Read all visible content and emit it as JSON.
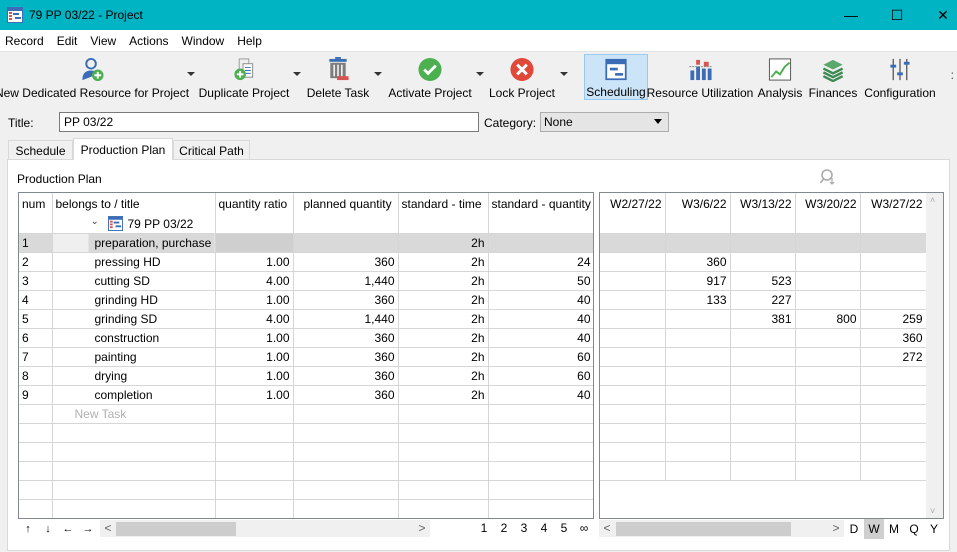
{
  "window": {
    "title": "79 PP 03/22 - Project",
    "controls": [
      "minimize",
      "maximize",
      "close"
    ]
  },
  "menu": [
    "Record",
    "Edit",
    "View",
    "Actions",
    "Window",
    "Help"
  ],
  "toolbar": {
    "buttons": [
      {
        "label": "New Dedicated Resource for Project",
        "icon": "add-user-icon",
        "has_dropdown": true
      },
      {
        "label": "Duplicate Project",
        "icon": "duplicate-icon",
        "has_dropdown": true
      },
      {
        "label": "Delete Task",
        "icon": "trash-icon",
        "has_dropdown": true
      },
      {
        "label": "Activate Project",
        "icon": "checkmark-icon",
        "has_dropdown": true
      },
      {
        "label": "Lock Project",
        "icon": "x-circle-icon",
        "has_dropdown": true
      },
      {
        "label": "Scheduling",
        "icon": "scheduling-icon",
        "active": true
      },
      {
        "label": "Resource Utilization",
        "icon": "bar-chart-icon"
      },
      {
        "label": "Analysis",
        "icon": "line-chart-icon"
      },
      {
        "label": "Finances",
        "icon": "money-icon"
      },
      {
        "label": "Configuration",
        "icon": "sliders-icon"
      }
    ],
    "overflow": ":"
  },
  "form": {
    "title_label": "Title:",
    "title_value": "PP 03/22",
    "category_label": "Category:",
    "category_value": "None"
  },
  "tabs": [
    {
      "label": "Schedule",
      "active": false
    },
    {
      "label": "Production Plan",
      "active": true
    },
    {
      "label": "Critical Path",
      "active": false
    }
  ],
  "section_title": "Production Plan",
  "left_grid": {
    "columns": [
      "num",
      "belongs to / title",
      "quantity ratio",
      "planned quantity",
      "standard - time",
      "standard - quantity"
    ],
    "project_row": {
      "label": "79 PP 03/22",
      "expanded": true
    },
    "rows": [
      {
        "num": "1",
        "title": "preparation, purchase",
        "quantity_ratio": "",
        "planned_quantity": "",
        "standard_time": "2h",
        "standard_quantity": "",
        "selected": true
      },
      {
        "num": "2",
        "title": "pressing HD",
        "quantity_ratio": "1.00",
        "planned_quantity": "360",
        "standard_time": "2h",
        "standard_quantity": "24"
      },
      {
        "num": "3",
        "title": "cutting SD",
        "quantity_ratio": "4.00",
        "planned_quantity": "1,440",
        "standard_time": "2h",
        "standard_quantity": "50"
      },
      {
        "num": "4",
        "title": "grinding HD",
        "quantity_ratio": "1.00",
        "planned_quantity": "360",
        "standard_time": "2h",
        "standard_quantity": "40"
      },
      {
        "num": "5",
        "title": "grinding SD",
        "quantity_ratio": "4.00",
        "planned_quantity": "1,440",
        "standard_time": "2h",
        "standard_quantity": "40"
      },
      {
        "num": "6",
        "title": "construction",
        "quantity_ratio": "1.00",
        "planned_quantity": "360",
        "standard_time": "2h",
        "standard_quantity": "40"
      },
      {
        "num": "7",
        "title": "painting",
        "quantity_ratio": "1.00",
        "planned_quantity": "360",
        "standard_time": "2h",
        "standard_quantity": "60"
      },
      {
        "num": "8",
        "title": "drying",
        "quantity_ratio": "1.00",
        "planned_quantity": "360",
        "standard_time": "2h",
        "standard_quantity": "60"
      },
      {
        "num": "9",
        "title": "completion",
        "quantity_ratio": "1.00",
        "planned_quantity": "360",
        "standard_time": "2h",
        "standard_quantity": "40"
      }
    ],
    "new_task_placeholder": "New Task",
    "nav_arrows": [
      "↑",
      "↓",
      "←",
      "→"
    ],
    "pages": [
      "1",
      "2",
      "3",
      "4",
      "5",
      "∞"
    ]
  },
  "right_grid": {
    "columns": [
      "W2/27/22",
      "W3/6/22",
      "W3/13/22",
      "W3/20/22",
      "W3/27/22"
    ],
    "rows": [
      [
        "",
        "",
        "",
        "",
        ""
      ],
      [
        "",
        "360",
        "",
        "",
        ""
      ],
      [
        "",
        "917",
        "523",
        "",
        ""
      ],
      [
        "",
        "133",
        "227",
        "",
        ""
      ],
      [
        "",
        "",
        "381",
        "800",
        "259"
      ],
      [
        "",
        "",
        "",
        "",
        "360"
      ],
      [
        "",
        "",
        "",
        "",
        "272"
      ],
      [
        "",
        "",
        "",
        "",
        ""
      ],
      [
        "",
        "",
        "",
        "",
        ""
      ]
    ],
    "scales": [
      {
        "label": "D",
        "active": false
      },
      {
        "label": "W",
        "active": true
      },
      {
        "label": "M",
        "active": false
      },
      {
        "label": "Q",
        "active": false
      },
      {
        "label": "Y",
        "active": false
      }
    ]
  }
}
